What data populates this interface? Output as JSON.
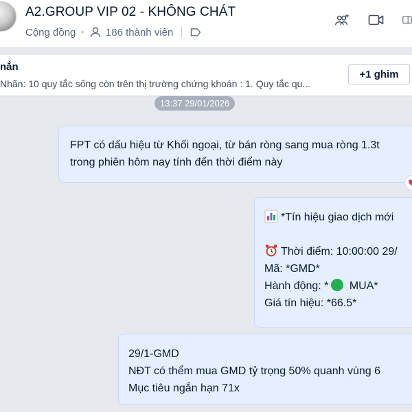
{
  "header": {
    "title": "A2.GROUP VIP 02 - KHÔNG CHÁT",
    "community": "Cộng đồng",
    "members": "186 thành viên",
    "icons": [
      "avatar",
      "members-icon",
      "tag-icon",
      "add-member-icon",
      "video-call-icon",
      "sidebar-toggle-icon"
    ]
  },
  "pinned": {
    "title": "nắn",
    "text": "Nhãn: 10 quy tắc sống còn trên thị trường chứng khoán :  1. Quy tắc qu...",
    "button": "+1 ghim"
  },
  "timestamp": "13:37 29/01/2026",
  "messages": [
    {
      "lines": [
        "FPT có dấu hiệu từ Khối ngoại, từ bán ròng sang mua ròng 1.3t",
        "trong phiên hôm nay tính đến thời điểm này"
      ]
    },
    {
      "line1": "*Tín hiệu giao dịch mới",
      "line2": "Thời điểm: 10:00:00 29/",
      "line3": "Mã: *GMD*",
      "line4_prefix": "Hành động: *",
      "line4_suffix": " MUA*",
      "line5": "Giá tín hiệu: *66.5*"
    },
    {
      "lines": [
        "29/1-GMD",
        "NĐT có thểm mua GMD tỷ trọng 50% quanh vùng 6",
        "Mục tiêu ngắn hạn 71x"
      ]
    }
  ],
  "colors": {
    "bubble_bg": "#e5efff",
    "chat_bg": "#e6e9ee",
    "signal_green": "#22b14c",
    "reaction_red": "#e8384f"
  }
}
